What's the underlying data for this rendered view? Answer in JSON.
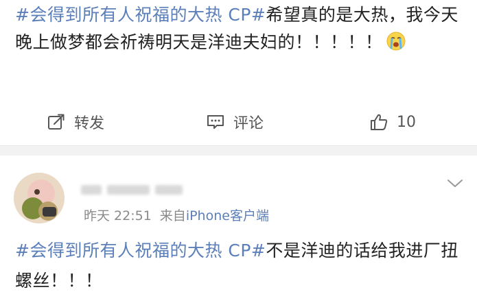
{
  "post": {
    "topic": "#会得到所有人祝福的大热 CP#",
    "body": "希望真的是大热，我今天晚上做梦都会祈祷明天是洋迪夫妇的！！！！！",
    "emoji_icon": "crying-face-icon"
  },
  "actions": {
    "repost_label": "转发",
    "comment_label": "评论",
    "like_count": "10"
  },
  "comment": {
    "time": "昨天 22:51",
    "source_prefix": "来自",
    "device": "iPhone客户端",
    "topic": "#会得到所有人祝福的大热 CP#",
    "body": "不是洋迪的话给我进厂扭螺丝！！！"
  },
  "colors": {
    "link": "#5b7fb8",
    "text": "#222222",
    "muted": "#8a8a8a",
    "divider_bg": "#f2f2f2"
  }
}
